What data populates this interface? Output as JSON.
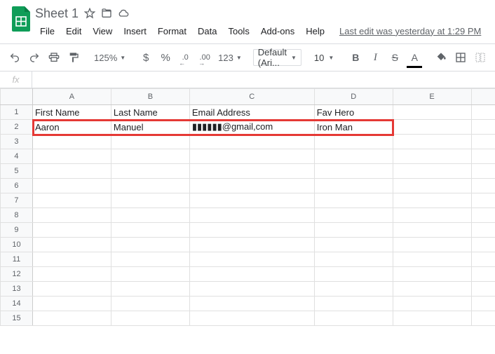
{
  "doc": {
    "title": "Sheet 1"
  },
  "menu": {
    "file": "File",
    "edit": "Edit",
    "view": "View",
    "insert": "Insert",
    "format": "Format",
    "data": "Data",
    "tools": "Tools",
    "addons": "Add-ons",
    "help": "Help",
    "last_edit": "Last edit was yesterday at 1:29 PM"
  },
  "toolbar": {
    "zoom": "125%",
    "currency": "$",
    "percent": "%",
    "dec_less": ".0",
    "dec_more": ".00",
    "numfmt": "123",
    "font": "Default (Ari...",
    "size": "10",
    "bold": "B",
    "italic": "I",
    "strike": "S",
    "textcolor": "A"
  },
  "fx": {
    "label": "fx",
    "value": ""
  },
  "columns": [
    "A",
    "B",
    "C",
    "D",
    "E",
    ""
  ],
  "rows": [
    "1",
    "2",
    "3",
    "4",
    "5",
    "6",
    "7",
    "8",
    "9",
    "10",
    "11",
    "12",
    "13",
    "14",
    "15"
  ],
  "sheet": {
    "r1": {
      "a": "First Name",
      "b": "Last Name",
      "c": "Email Address",
      "d": "Fav Hero"
    },
    "r2": {
      "a": "Aaron",
      "b": "Manuel",
      "c": "▮▮▮▮▮▮@gmail,com",
      "d": "Iron Man"
    }
  }
}
